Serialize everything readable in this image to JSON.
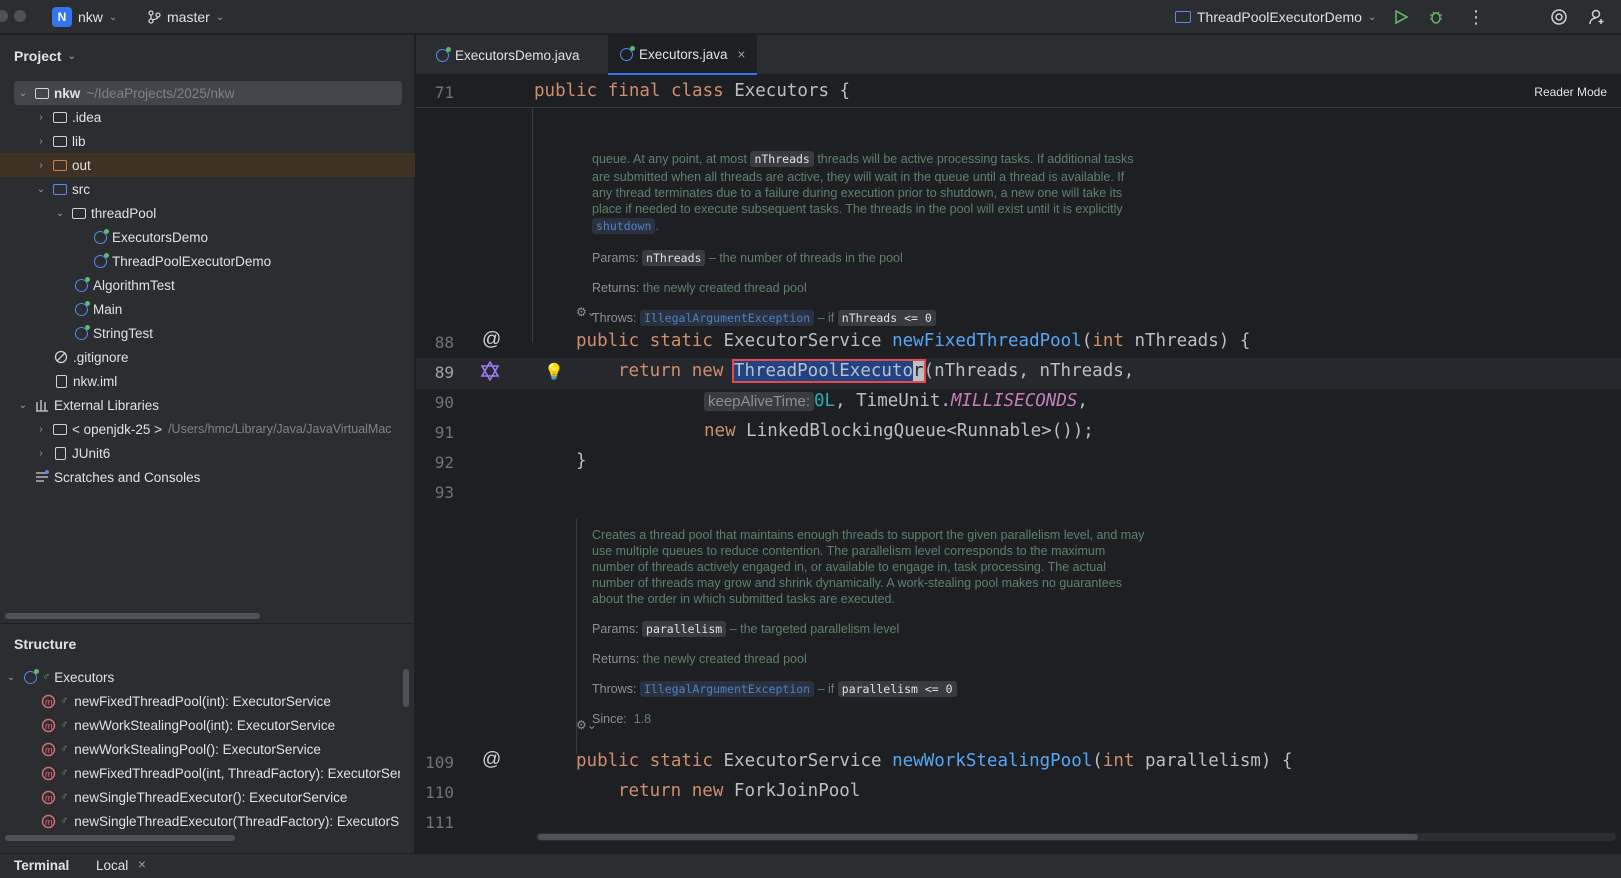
{
  "titlebar": {
    "project_badge": "N",
    "project_name": "nkw",
    "branch": "master",
    "run_config": "ThreadPoolExecutorDemo"
  },
  "project_panel": {
    "title": "Project",
    "tree": [
      {
        "label": "nkw",
        "hint": "~/IdeaProjects/2025/nkw",
        "icon": "module-folder-icon"
      },
      {
        "label": ".idea",
        "icon": "folder-icon"
      },
      {
        "label": "lib",
        "icon": "folder-icon"
      },
      {
        "label": "out",
        "icon": "folder-orange-icon"
      },
      {
        "label": "src",
        "icon": "source-folder-icon"
      },
      {
        "label": "threadPool",
        "icon": "package-icon"
      },
      {
        "label": "ExecutorsDemo",
        "icon": "class-icon"
      },
      {
        "label": "ThreadPoolExecutorDemo",
        "icon": "class-icon"
      },
      {
        "label": "AlgorithmTest",
        "icon": "class-icon"
      },
      {
        "label": "Main",
        "icon": "class-icon"
      },
      {
        "label": "StringTest",
        "icon": "class-icon"
      },
      {
        "label": ".gitignore",
        "icon": "ignore-file-icon"
      },
      {
        "label": "nkw.iml",
        "icon": "file-icon"
      },
      {
        "label": "External Libraries",
        "icon": "library-icon"
      },
      {
        "label": "< openjdk-25 >",
        "hint": "/Users/hmc/Library/Java/JavaVirtualMac",
        "icon": "jdk-icon"
      },
      {
        "label": "JUnit6",
        "icon": "library-icon"
      },
      {
        "label": "Scratches and Consoles",
        "icon": "scratches-icon"
      }
    ]
  },
  "structure_panel": {
    "title": "Structure",
    "root": "Executors",
    "items": [
      "newFixedThreadPool(int): ExecutorService",
      "newWorkStealingPool(int): ExecutorService",
      "newWorkStealingPool(): ExecutorService",
      "newFixedThreadPool(int, ThreadFactory): ExecutorSer",
      "newSingleThreadExecutor(): ExecutorService",
      "newSingleThreadExecutor(ThreadFactory): ExecutorS"
    ]
  },
  "tabs": [
    {
      "label": "ExecutorsDemo.java"
    },
    {
      "label": "Executors.java"
    }
  ],
  "editor": {
    "reader_mode": "Reader Mode",
    "sticky_line": "71",
    "lines": {
      "l88": "88",
      "l89": "89",
      "l90": "90",
      "l91": "91",
      "l92": "92",
      "l93": "93",
      "l109": "109",
      "l110": "110",
      "l111": "111"
    },
    "doc1": {
      "line1": "queue. At any point, at most",
      "code1": "nThreads",
      "line1b": "threads will be active processing tasks. If additional tasks",
      "line2": "are submitted when all threads are active, they will wait in the queue until a thread is available. If",
      "line3": "any thread terminates due to a failure during execution prior to shutdown, a new one will take its",
      "line4": "place if needed to execute subsequent tasks. The threads in the pool will exist until it is explicitly",
      "link1": "shutdown",
      "params_label": "Params:",
      "params_code": "nThreads",
      "params_text": "– the number of threads in the pool",
      "returns_label": "Returns:",
      "returns_text": "the newly created thread pool",
      "throws_label": "Throws:",
      "throws_link": "IllegalArgumentException",
      "throws_if": "– if",
      "throws_code": "nThreads <= 0"
    },
    "doc2": {
      "line1": "Creates a thread pool that maintains enough threads to support the given parallelism level, and may",
      "line2": "use multiple queues to reduce contention. The parallelism level corresponds to the maximum",
      "line3": "number of threads actively engaged in, or available to engage in, task processing. The actual",
      "line4": "number of threads may grow and shrink dynamically. A work-stealing pool makes no guarantees",
      "line5": "about the order in which submitted tasks are executed.",
      "params_label": "Params:",
      "params_code": "parallelism",
      "params_text": "– the targeted parallelism level",
      "returns_label": "Returns:",
      "returns_text": "the newly created thread pool",
      "throws_label": "Throws:",
      "throws_link": "IllegalArgumentException",
      "throws_if": "– if",
      "throws_code": "parallelism <= 0",
      "since_label": "Since:",
      "since_text": "1.8"
    },
    "code": {
      "c71_a": "public final class",
      "c71_b": "Executors {",
      "c88_a": "public static",
      "c88_b": "ExecutorService",
      "c88_c": "newFixedThreadPool",
      "c88_d": "(",
      "c88_e": "int",
      "c88_f": "nThreads) {",
      "c89_a": "return new",
      "c89_sel": "ThreadPoolExecuto",
      "c89_cur": "r",
      "c89_b": "(nThreads, nThreads,",
      "c90_hint": "keepAliveTime:",
      "c90_num": "0L",
      "c90_b": ", TimeUnit.",
      "c90_st": "MILLISECONDS",
      "c90_c": ",",
      "c91_kw": "new",
      "c91_b": "LinkedBlockingQueue<Runnable>());",
      "c92": "}",
      "c109_a": "public static",
      "c109_b": "ExecutorService",
      "c109_c": "newWorkStealingPool",
      "c109_d": "(",
      "c109_e": "int",
      "c109_f": "parallelism) {",
      "c110_a": "return new",
      "c110_b": "ForkJoinPool"
    }
  },
  "statusbar": {
    "terminal": "Terminal",
    "local": "Local"
  }
}
